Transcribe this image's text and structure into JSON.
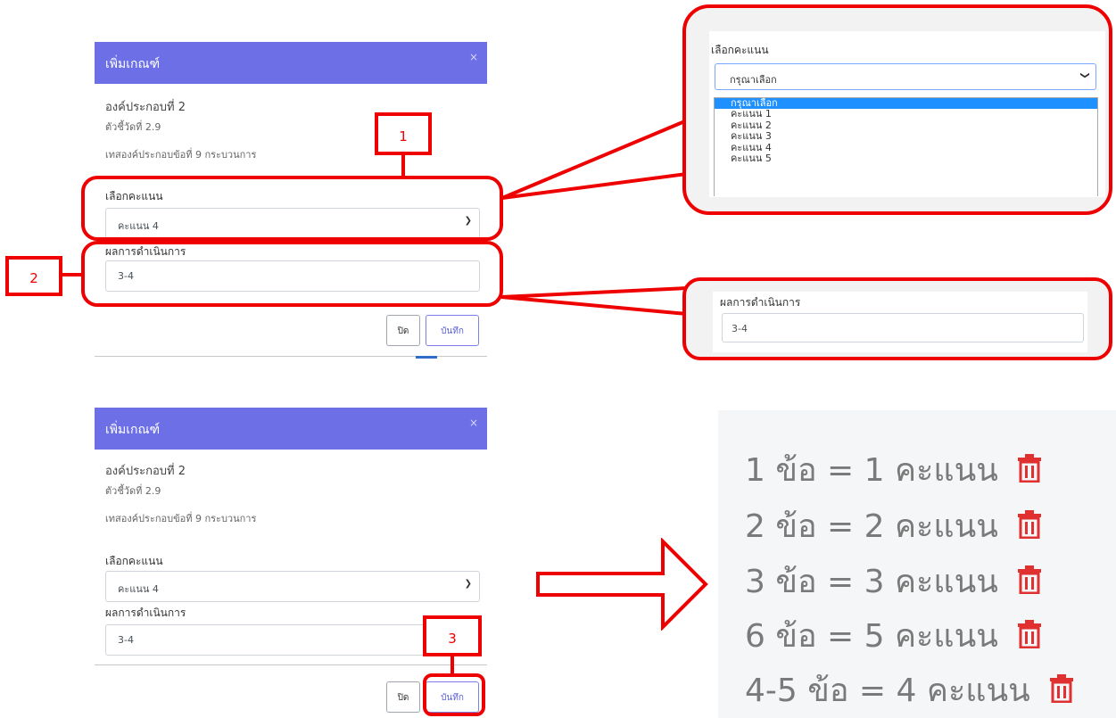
{
  "modal": {
    "title": "เพิ่มเกณฑ์",
    "close_icon": "×",
    "component": "องค์ประกอบที่ 2",
    "indicator": "ตัวชี้วัดที่ 2.9",
    "description": "เทสองค์ประกอบข้อที่ 9 กระบวนการ",
    "score_label": "เลือกคะแนน",
    "score_value": "คะแนน 4",
    "result_label": "ผลการดำเนินการ",
    "result_value": "3-4",
    "close_button": "ปิด",
    "save_button": "บันทึก"
  },
  "annotations": {
    "step1": "1",
    "step2": "2",
    "step3": "3"
  },
  "callout_dropdown": {
    "label": "เลือกคะแนน",
    "selected": "กรุณาเลือก",
    "options": [
      "กรุณาเลือก",
      "คะแนน 1",
      "คะแนน 2",
      "คะแนน 3",
      "คะแนน 4",
      "คะแนน 5"
    ]
  },
  "callout_result": {
    "label": "ผลการดำเนินการ",
    "value": "3-4"
  },
  "score_list": [
    "1 ข้อ = 1 คะแนน",
    "2 ข้อ = 2 คะแนน",
    "3 ข้อ = 3 คะแนน",
    "6 ข้อ = 5 คะแนน",
    "4-5 ข้อ = 4 คะแนน"
  ],
  "colors": {
    "header": "#6c6fe6",
    "annotation_red": "#e00000",
    "selected_option": "#1e90ff",
    "trash_icon": "#e03030"
  }
}
